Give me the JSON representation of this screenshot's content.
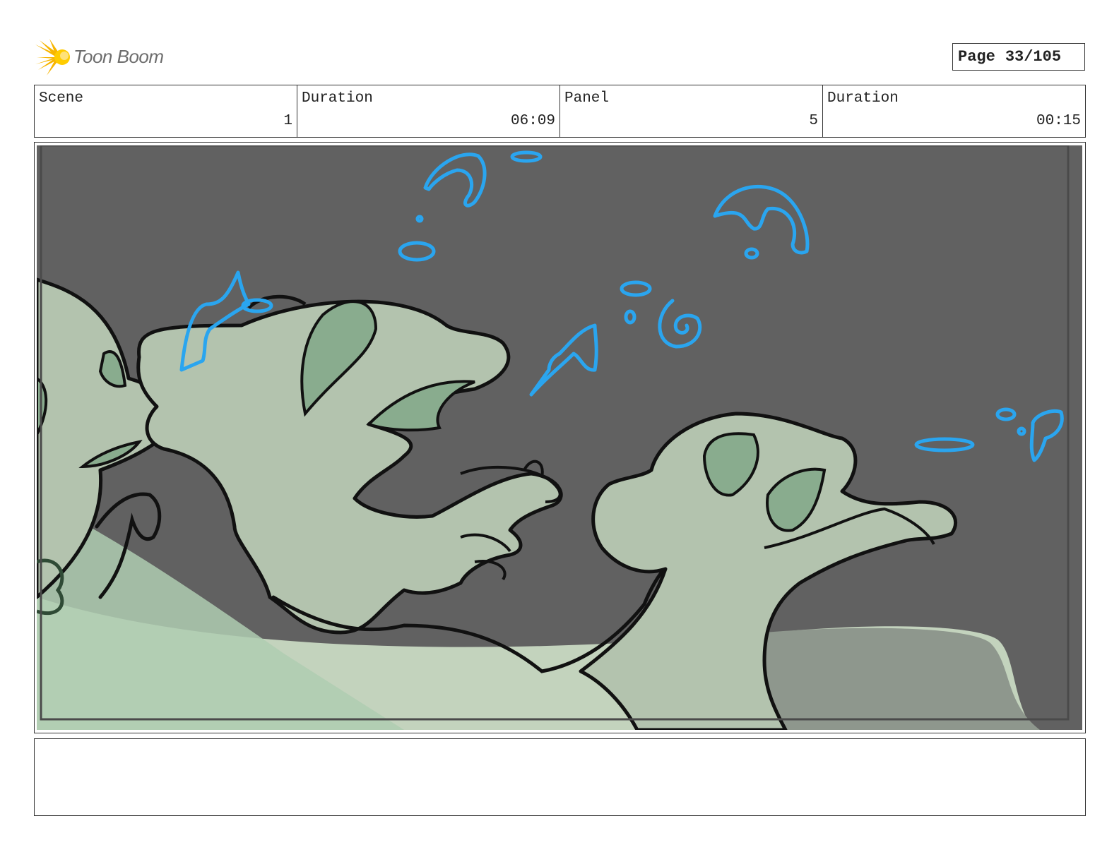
{
  "logo": {
    "text": "Toon Boom"
  },
  "page": {
    "label": "Page",
    "value": "33/105"
  },
  "header": [
    {
      "label": "Scene",
      "value": "1"
    },
    {
      "label": "Duration",
      "value": "06:09"
    },
    {
      "label": "Panel",
      "value": "5"
    },
    {
      "label": "Duration",
      "value": "00:15"
    }
  ],
  "colors": {
    "background_dark": "#616161",
    "creature_fill": "#b3c3ae",
    "creature_inner": "#89ac8e",
    "ground_light": "#c3d3bd",
    "ground_green": "#afccb2",
    "scribble_blue": "#2aa5ef",
    "outline": "#111111"
  },
  "notes": {
    "text": ""
  }
}
